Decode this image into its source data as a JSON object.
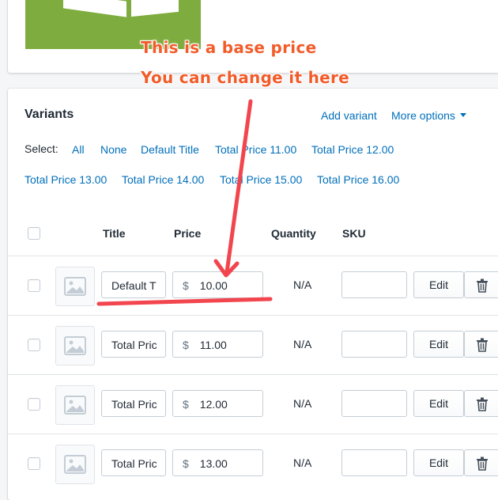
{
  "annotations": {
    "line1": "This is a base price",
    "line2": "You can change it here"
  },
  "variants": {
    "title": "Variants",
    "add_variant": "Add variant",
    "more_options": "More options",
    "select_label": "Select:",
    "select_links": [
      "All",
      "None",
      "Default Title",
      "Total Price 11.00",
      "Total Price 12.00",
      "Total Price 13.00",
      "Total Price 14.00",
      "Total Price 15.00",
      "Total Price 16.00"
    ],
    "columns": {
      "title": "Title",
      "price": "Price",
      "quantity": "Quantity",
      "sku": "SKU"
    },
    "currency": "$",
    "edit_label": "Edit",
    "rows": [
      {
        "title": "Default T",
        "price": "10.00",
        "quantity": "N/A",
        "sku": ""
      },
      {
        "title": "Total Pric",
        "price": "11.00",
        "quantity": "N/A",
        "sku": ""
      },
      {
        "title": "Total Pric",
        "price": "12.00",
        "quantity": "N/A",
        "sku": ""
      },
      {
        "title": "Total Pric",
        "price": "13.00",
        "quantity": "N/A",
        "sku": ""
      }
    ]
  },
  "colors": {
    "link": "#006fbb",
    "annotation": "#f25c2a",
    "annotation_arrow": "#f2454e",
    "product_image": "#7fac3e"
  },
  "icons": {
    "image_placeholder": "image-placeholder-icon",
    "trash": "trash-icon",
    "caret": "caret-down-icon"
  }
}
